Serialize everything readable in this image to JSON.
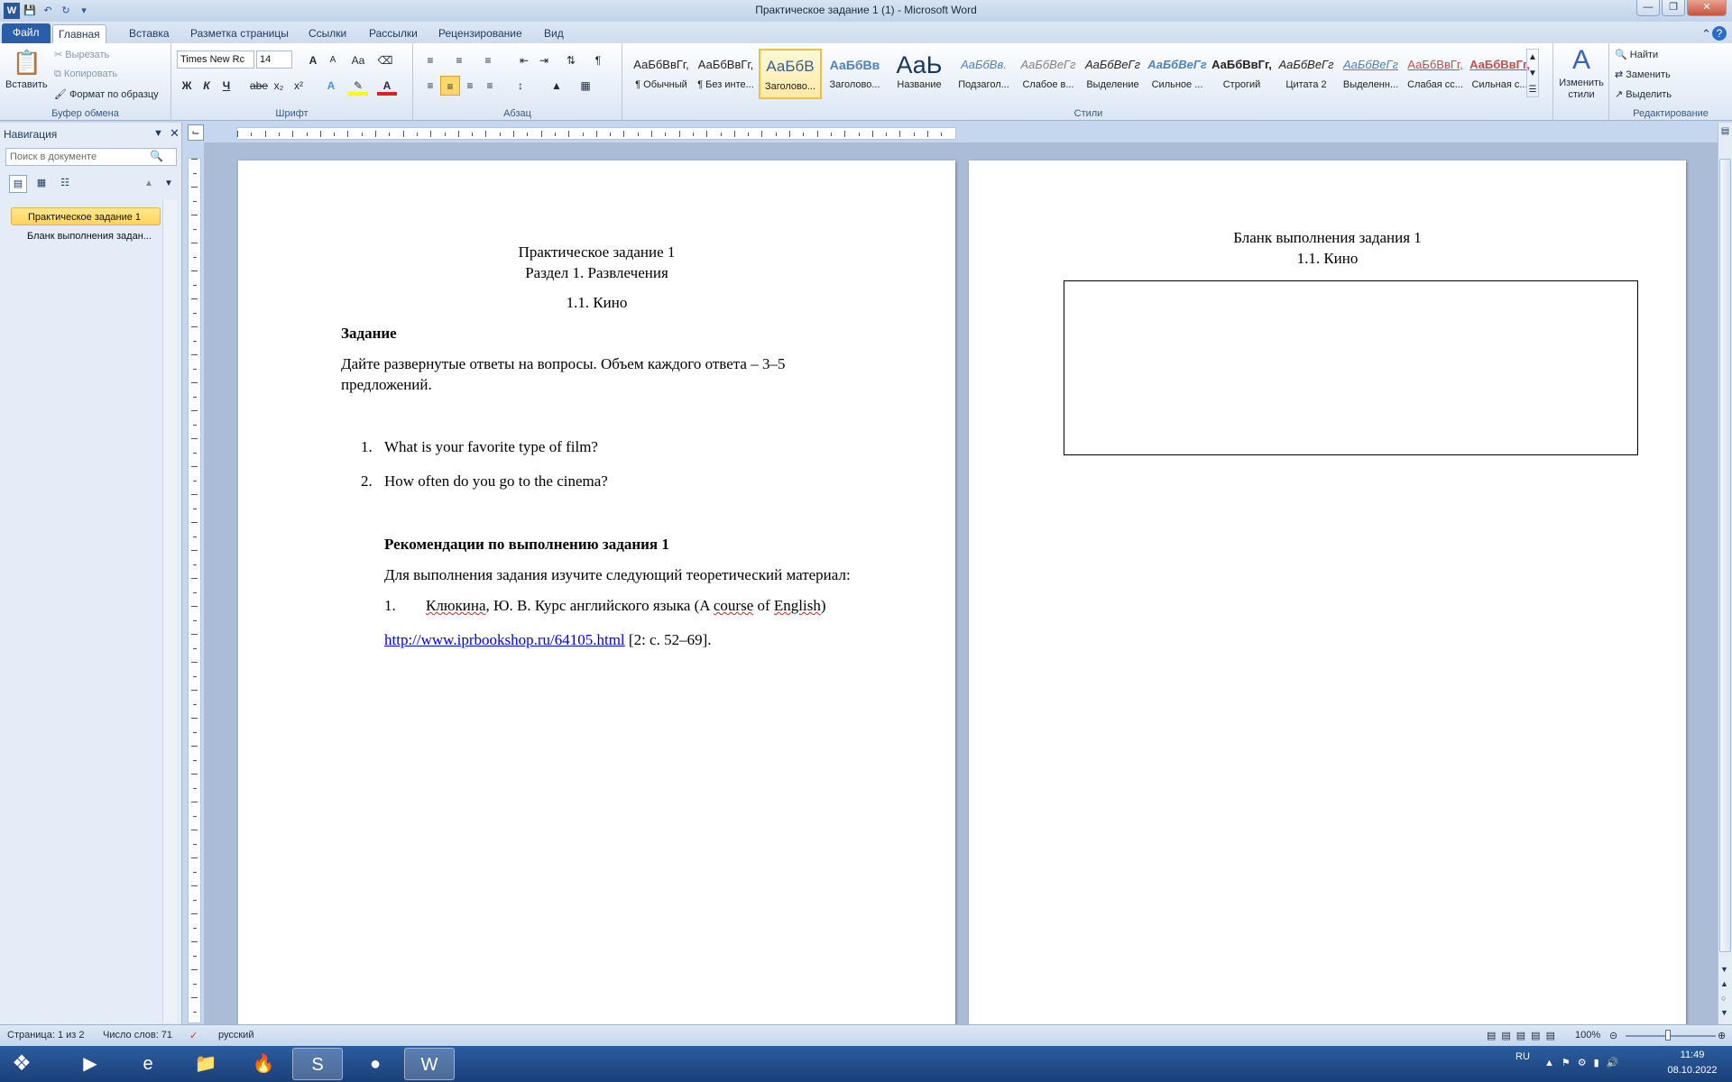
{
  "window": {
    "title": "Практическое задание 1 (1)  -  Microsoft Word"
  },
  "tabs": [
    "Файл",
    "Главная",
    "Вставка",
    "Разметка страницы",
    "Ссылки",
    "Рассылки",
    "Рецензирование",
    "Вид"
  ],
  "clipboard": {
    "paste": "Вставить",
    "cut": "Вырезать",
    "copy": "Копировать",
    "format_painter": "Формат по образцу",
    "label": "Буфер обмена"
  },
  "font": {
    "name": "Times New Rc",
    "size": "14",
    "label": "Шрифт",
    "bold": "Ж",
    "italic": "К",
    "underline": "Ч",
    "strike": "abe",
    "sub": "x₂",
    "sup": "x²",
    "grow": "A",
    "shrink": "A",
    "case": "Aa"
  },
  "paragraph": {
    "label": "Абзац"
  },
  "styles": {
    "label": "Стили",
    "items": [
      {
        "sample": "АаБбВвГг,",
        "name": "¶ Обычный"
      },
      {
        "sample": "АаБбВвГг,",
        "name": "¶ Без инте..."
      },
      {
        "sample": "АаБбВ",
        "name": "Заголово..."
      },
      {
        "sample": "АаБбВв",
        "name": "Заголово..."
      },
      {
        "sample": "АаЬ",
        "name": "Название"
      },
      {
        "sample": "АаБбВв.",
        "name": "Подзагол..."
      },
      {
        "sample": "АаБбВеГг",
        "name": "Слабое в..."
      },
      {
        "sample": "АаБбВеГг",
        "name": "Выделение"
      },
      {
        "sample": "АаБбВеГг",
        "name": "Сильное ..."
      },
      {
        "sample": "АаБбВвГг,",
        "name": "Строгий"
      },
      {
        "sample": "АаБбВеГг",
        "name": "Цитата 2"
      },
      {
        "sample": "АаБбВеГг",
        "name": "Выделенн..."
      },
      {
        "sample": "АаБбВвГг,",
        "name": "Слабая сс..."
      },
      {
        "sample": "АаБбВвГг,",
        "name": "Сильная с..."
      }
    ],
    "change": "Изменить стили"
  },
  "editing": {
    "find": "Найти",
    "replace": "Заменить",
    "select": "Выделить",
    "label": "Редактирование"
  },
  "nav": {
    "title": "Навигация",
    "search_placeholder": "Поиск в документе",
    "items": [
      "Практическое задание 1",
      "Бланк выполнения задан..."
    ]
  },
  "page1": {
    "title": "Практическое задание 1",
    "section": "Раздел 1. Развлечения",
    "subsection": "1.1. Кино",
    "task_heading": "Задание",
    "task_line1": "Дайте  развернутые  ответы  на  вопросы.  Объем  каждого  ответа  –  3–5",
    "task_line2": "предложений.",
    "q1_num": "1.",
    "q1": "What is your favorite type of film?",
    "q2_num": "2.",
    "q2": "How often do you go to the cinema?",
    "rec_heading": "Рекомендации по выполнению задания 1",
    "rec_text": "Для выполнения задания изучите следующий теоретический материал:",
    "ref_num": "1.",
    "ref_author": "Клюкина",
    "ref_rest": ", Ю. В. Курс английского языка (A ",
    "ref_course": "course",
    "ref_of": " of ",
    "ref_english": "English",
    "ref_close": ")",
    "url": "http://www.iprbookshop.ru/64105.html",
    "pages": " [2: с. 52–69]."
  },
  "page2": {
    "title": "Бланк выполнения задания 1",
    "subsection": "1.1. Кино"
  },
  "status": {
    "page": "Страница: 1 из 2",
    "words": "Число слов: 71",
    "lang": "русский",
    "zoom": "100%"
  },
  "taskbar": {
    "lang": "RU",
    "time": "11:49",
    "date": "08.10.2022"
  }
}
